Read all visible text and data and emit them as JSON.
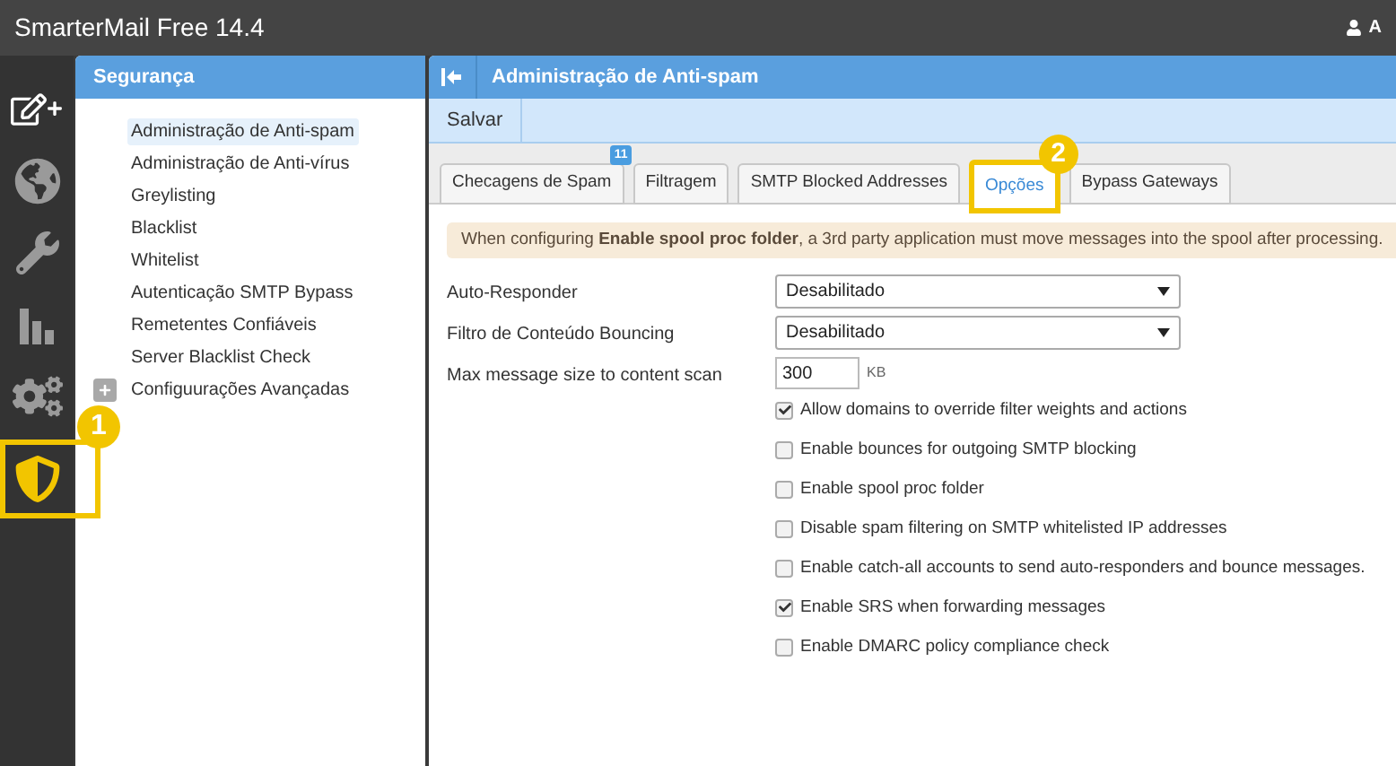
{
  "app": {
    "title": "SmarterMail Free 14.4",
    "user": "A"
  },
  "rail": [
    {
      "kind": "compose",
      "highlighted": false
    },
    {
      "kind": "globe",
      "highlighted": false
    },
    {
      "kind": "wrench",
      "highlighted": false
    },
    {
      "kind": "chart",
      "highlighted": false
    },
    {
      "kind": "gears",
      "highlighted": false
    },
    {
      "kind": "shield",
      "highlighted": true
    }
  ],
  "sidebar": {
    "title": "Segurança",
    "items": [
      {
        "label": "Administração de Anti-spam",
        "selected": true,
        "expandable": false
      },
      {
        "label": "Administração de Anti-vírus",
        "selected": false,
        "expandable": false
      },
      {
        "label": "Greylisting",
        "selected": false,
        "expandable": false
      },
      {
        "label": "Blacklist",
        "selected": false,
        "expandable": false
      },
      {
        "label": "Whitelist",
        "selected": false,
        "expandable": false
      },
      {
        "label": "Autenticação SMTP Bypass",
        "selected": false,
        "expandable": false
      },
      {
        "label": "Remetentes Confiáveis",
        "selected": false,
        "expandable": false
      },
      {
        "label": "Server Blacklist Check",
        "selected": false,
        "expandable": false
      },
      {
        "label": "Configuurações Avançadas",
        "selected": false,
        "expandable": true
      }
    ]
  },
  "main": {
    "title": "Administração de Anti-spam",
    "toolbar": [
      "Salvar"
    ],
    "tabs": [
      {
        "label": "Checagens de Spam",
        "selected": false,
        "highlighted": false,
        "badge": "11"
      },
      {
        "label": "Filtragem",
        "selected": false,
        "highlighted": false
      },
      {
        "label": "SMTP Blocked Addresses",
        "selected": false,
        "highlighted": false
      },
      {
        "label": "Opções",
        "selected": true,
        "highlighted": true
      },
      {
        "label": "Bypass Gateways",
        "selected": false,
        "highlighted": false
      }
    ],
    "notice": "When configuring **Enable spool proc folder**, a 3rd party application must move messages into the spool after processing.",
    "fields": [
      {
        "kind": "select",
        "label": "Auto-Responder",
        "value": "Desabilitado"
      },
      {
        "kind": "select",
        "label": "Filtro de Conteúdo Bouncing",
        "value": "Desabilitado"
      },
      {
        "kind": "number",
        "label": "Max message size to content scan",
        "value": "300",
        "unit": "KB"
      }
    ],
    "checkboxes": [
      {
        "label": "Allow domains to override filter weights and actions",
        "checked": true
      },
      {
        "label": "Enable bounces for outgoing SMTP blocking",
        "checked": false
      },
      {
        "label": "Enable spool proc folder",
        "checked": false
      },
      {
        "label": "Disable spam filtering on SMTP whitelisted IP addresses",
        "checked": false
      },
      {
        "label": "Enable catch-all accounts to send auto-responders and bounce messages.",
        "checked": false
      },
      {
        "label": "Enable SRS when forwarding messages",
        "checked": true
      },
      {
        "label": "Enable DMARC policy compliance check",
        "checked": false
      }
    ]
  },
  "callouts": [
    {
      "label": "1"
    },
    {
      "label": "2"
    }
  ]
}
